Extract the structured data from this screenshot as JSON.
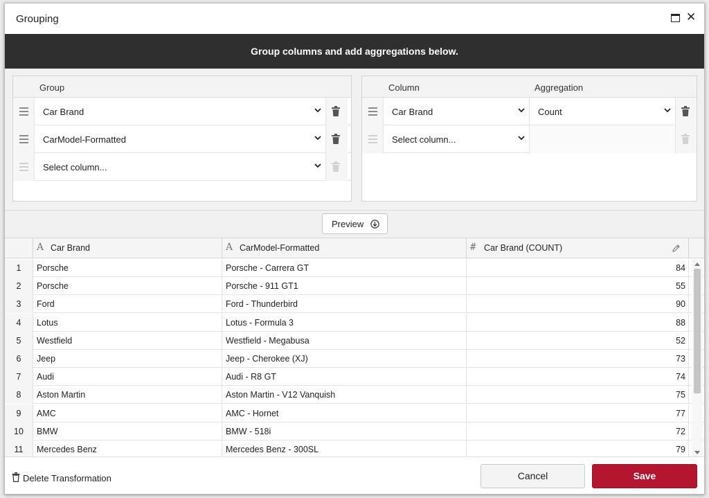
{
  "dialog": {
    "title": "Grouping",
    "banner": "Group columns and add aggregations below."
  },
  "group_panel": {
    "header": "Group",
    "rows": [
      {
        "value": "Car Brand"
      },
      {
        "value": "CarModel-Formatted"
      },
      {
        "value": "Select column..."
      }
    ]
  },
  "agg_panel": {
    "column_header": "Column",
    "aggregation_header": "Aggregation",
    "rows": [
      {
        "column": "Car Brand",
        "aggregation": "Count"
      },
      {
        "column": "Select column...",
        "aggregation": ""
      }
    ]
  },
  "preview": {
    "label": "Preview"
  },
  "grid": {
    "columns": [
      {
        "label": "Car Brand",
        "type_icon": "A"
      },
      {
        "label": "CarModel-Formatted",
        "type_icon": "A"
      },
      {
        "label": "Car Brand (COUNT)",
        "type_icon": "#"
      }
    ],
    "rows": [
      {
        "n": "1",
        "brand": "Porsche",
        "model": "Porsche - Carrera GT",
        "count": "84"
      },
      {
        "n": "2",
        "brand": "Porsche",
        "model": "Porsche - 911 GT1",
        "count": "55"
      },
      {
        "n": "3",
        "brand": "Ford",
        "model": "Ford - Thunderbird",
        "count": "90"
      },
      {
        "n": "4",
        "brand": "Lotus",
        "model": "Lotus - Formula 3",
        "count": "88"
      },
      {
        "n": "5",
        "brand": "Westfield",
        "model": "Westfield - Megabusa",
        "count": "52"
      },
      {
        "n": "6",
        "brand": "Jeep",
        "model": "Jeep - Cherokee (XJ)",
        "count": "73"
      },
      {
        "n": "7",
        "brand": "Audi",
        "model": "Audi - R8 GT",
        "count": "74"
      },
      {
        "n": "8",
        "brand": "Aston Martin",
        "model": "Aston Martin - V12 Vanquish",
        "count": "75"
      },
      {
        "n": "9",
        "brand": "AMC",
        "model": "AMC - Hornet",
        "count": "77"
      },
      {
        "n": "10",
        "brand": "BMW",
        "model": "BMW - 518i",
        "count": "72"
      },
      {
        "n": "11",
        "brand": "Mercedes Benz",
        "model": "Mercedes Benz - 300SL",
        "count": "79"
      }
    ]
  },
  "footer": {
    "delete_label": "Delete Transformation",
    "cancel_label": "Cancel",
    "save_label": "Save"
  },
  "colors": {
    "banner_bg": "#2f2f2f",
    "save_bg": "#b4152f"
  }
}
